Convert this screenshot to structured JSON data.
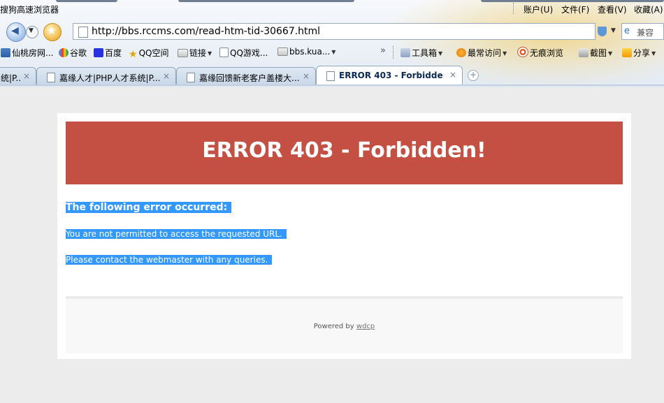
{
  "browser": {
    "title": "搜狗高速浏览器",
    "menu": [
      {
        "label": "账户(U)"
      },
      {
        "label": "文件(F)"
      },
      {
        "label": "查看(V)"
      },
      {
        "label": "收藏(A)"
      }
    ],
    "address": "http://bbs.rccms.com/read-htm-tid-30667.html",
    "compat_label": "兼容",
    "bookmarks": [
      {
        "label": "仙桃房网...",
        "icon": "home-icon"
      },
      {
        "label": "谷歌",
        "icon": "google-icon"
      },
      {
        "label": "百度",
        "icon": "baidu-icon"
      },
      {
        "label": "QQ空间",
        "icon": "star-icon"
      },
      {
        "label": "链接",
        "icon": "folder-icon"
      },
      {
        "label": "QQ游戏...",
        "icon": "page-icon"
      },
      {
        "label": "bbs.kua...",
        "icon": "folder-icon"
      }
    ],
    "overflow_label": "»",
    "tools": [
      {
        "label": "工具箱",
        "icon": "toolbox-icon"
      },
      {
        "label": "最常访问",
        "icon": "frequent-icon"
      },
      {
        "label": "无痕浏览",
        "icon": "incognito-icon"
      },
      {
        "label": "截图",
        "icon": "screenshot-icon"
      },
      {
        "label": "分享",
        "icon": "share-icon"
      }
    ],
    "tabs": [
      {
        "label": "统|P..."
      },
      {
        "label": "嘉缘人才|PHP人才系统|P..."
      },
      {
        "label": "嘉缘回馈新老客户盖楼大..."
      },
      {
        "label": "ERROR 403 - Forbidde..."
      }
    ],
    "close_glyph": "×"
  },
  "page": {
    "error_title": "ERROR 403 - Forbidden!",
    "error_heading": "The following error occurred:",
    "error_message": "You are not permitted to access the requested URL.",
    "contact_message": "Please contact the webmaster with any queries.",
    "powered_by": "Powered by",
    "powered_link": "wdcp"
  },
  "colors": {
    "banner": "#c35042",
    "selection": "#3399ff",
    "page_background": "#ececec"
  }
}
